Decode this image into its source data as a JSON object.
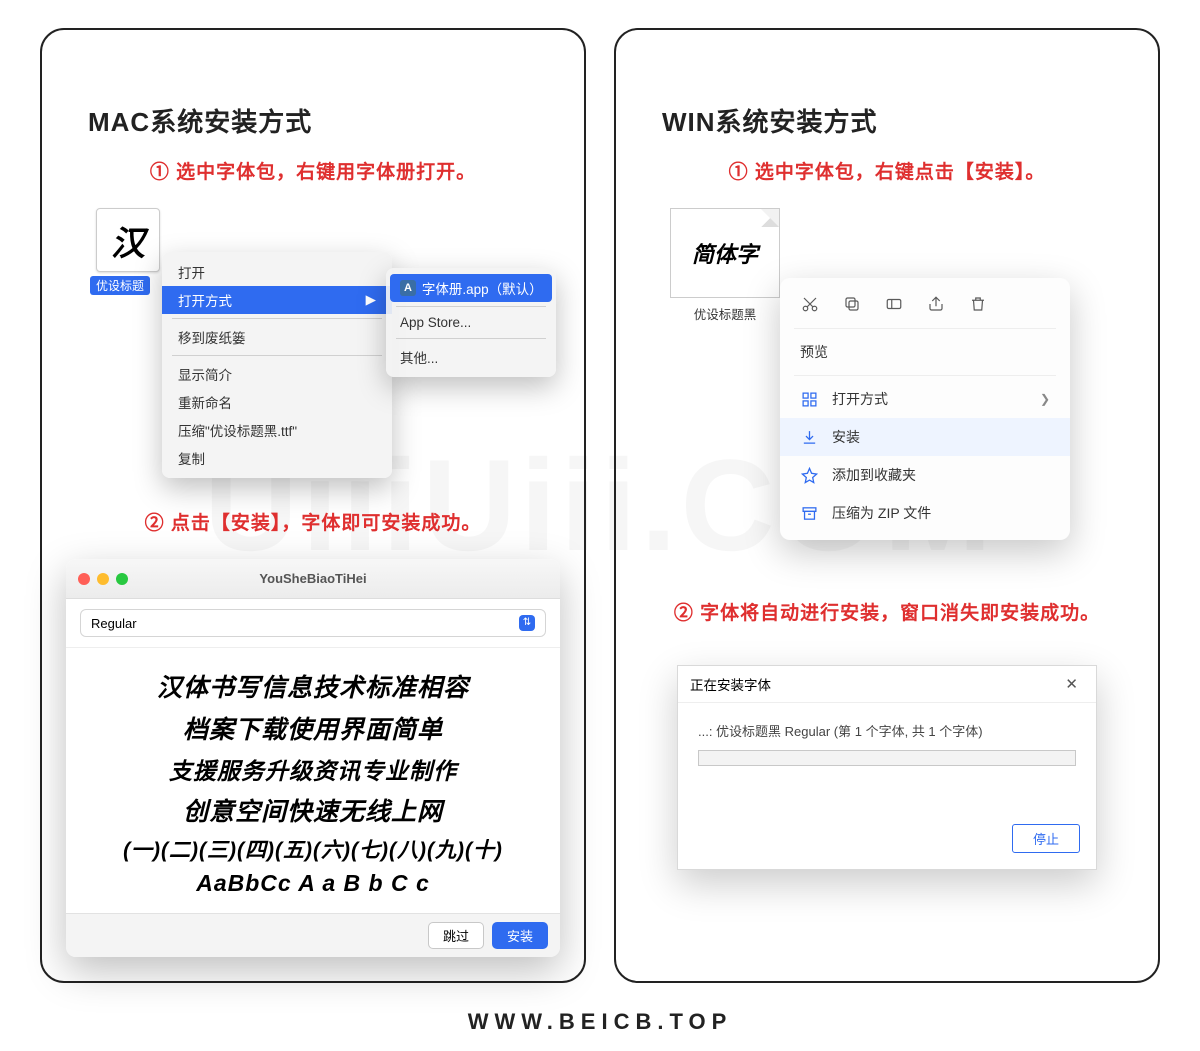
{
  "watermark": "UiiiUiii.COM",
  "footer_url": "WWW.BEICB.TOP",
  "mac": {
    "panel_title": "MAC系统安装方式",
    "step1": "① 选中字体包，右键用字体册打开。",
    "step2": "② 点击【安装】，字体即可安装成功。",
    "file_glyph": "汉",
    "file_label": "优设标题",
    "menu": {
      "open": "打开",
      "open_with": "打开方式",
      "trash": "移到废纸篓",
      "info": "显示简介",
      "rename": "重新命名",
      "compress": "压缩\"优设标题黑.ttf\"",
      "copy": "复制"
    },
    "submenu": {
      "fontbook": "字体册.app（默认）",
      "appstore": "App Store...",
      "other": "其他..."
    },
    "fontbook": {
      "title": "YouSheBiaoTiHei",
      "style": "Regular",
      "preview": [
        "汉体书写信息技术标准相容",
        "档案下载使用界面简单",
        "支援服务升级资讯专业制作",
        "创意空间快速无线上网",
        "(一)(二)(三)(四)(五)(六)(七)(八)(九)(十)",
        "AaBbCc  A a B b C c"
      ],
      "skip": "跳过",
      "install": "安装"
    }
  },
  "win": {
    "panel_title": "WIN系统安装方式",
    "step1": "① 选中字体包，右键点击【安装】。",
    "step2": "② 字体将自动进行安装，窗口消失即安装成功。",
    "file_glyph": "简体字",
    "file_label": "优设标题黑",
    "menu": {
      "preview": "预览",
      "open_with": "打开方式",
      "install": "安装",
      "favorite": "添加到收藏夹",
      "zip": "压缩为 ZIP 文件"
    },
    "dialog": {
      "title": "正在安装字体",
      "body": "...: 优设标题黑 Regular (第 1 个字体, 共 1 个字体)",
      "stop": "停止"
    }
  }
}
